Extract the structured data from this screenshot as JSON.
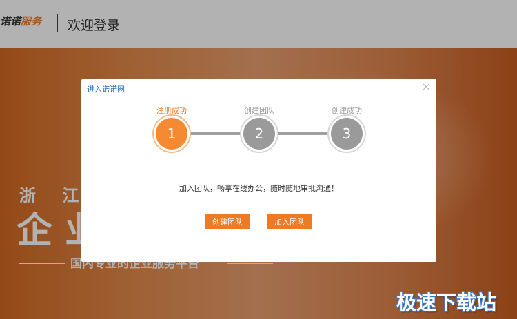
{
  "header": {
    "logo_part1": "诺诺",
    "logo_part2": "服务",
    "title": "欢迎登录"
  },
  "hero": {
    "line1": "浙 江 数",
    "line2": "企 业",
    "line3": "国内专业的企业服务平台"
  },
  "dialog": {
    "title": "进入诺诺网",
    "close_icon": "close-icon",
    "steps": [
      {
        "label": "注册成功",
        "number": "1",
        "active": true
      },
      {
        "label": "创建团队",
        "number": "2",
        "active": false
      },
      {
        "label": "创建成功",
        "number": "3",
        "active": false
      }
    ],
    "message": "加入团队，畅享在线办公，随时随地审批沟通！",
    "create_team_label": "创建团队",
    "join_team_label": "加入团队"
  },
  "watermark": "极速下载站",
  "colors": {
    "accent": "#f07a22",
    "inactive_step": "#9a9a9a",
    "title_blue": "#2f6fb4"
  }
}
